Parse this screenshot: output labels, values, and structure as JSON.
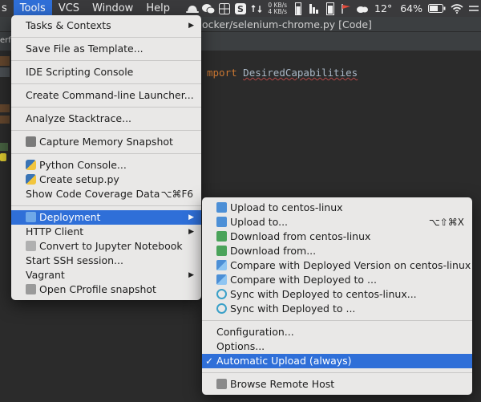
{
  "menubar": {
    "items": [
      "s",
      "Tools",
      "VCS",
      "Window",
      "Help"
    ],
    "net_up": "0 KB/s",
    "net_down": "4 KB/s",
    "temperature": "12°",
    "battery": "64%"
  },
  "ide": {
    "title": "ocker/selenium-chrome.py [Code]",
    "sub_fragment": "erf",
    "code_import_kw": "mport",
    "code_import_cls": "DesiredCapabilities"
  },
  "tools_menu": {
    "items": [
      {
        "label": "Tasks & Contexts"
      },
      {
        "label": "Save File as Template..."
      },
      {
        "label": "IDE Scripting Console"
      },
      {
        "label": "Create Command-line Launcher..."
      },
      {
        "label": "Analyze Stacktrace..."
      },
      {
        "label": "Capture Memory Snapshot"
      },
      {
        "label": "Python Console..."
      },
      {
        "label": "Create setup.py"
      },
      {
        "label": "Show Code Coverage Data",
        "shortcut": "⌥⌘F6"
      },
      {
        "label": "Deployment"
      },
      {
        "label": "HTTP Client"
      },
      {
        "label": "Convert to Jupyter Notebook"
      },
      {
        "label": "Start SSH session..."
      },
      {
        "label": "Vagrant"
      },
      {
        "label": "Open CProfile snapshot"
      }
    ]
  },
  "deploy_menu": {
    "items": [
      {
        "label": "Upload to centos-linux"
      },
      {
        "label": "Upload to...",
        "shortcut": "⌥⇧⌘X"
      },
      {
        "label": "Download from centos-linux"
      },
      {
        "label": "Download from..."
      },
      {
        "label": "Compare with Deployed Version on centos-linux"
      },
      {
        "label": "Compare with Deployed to ..."
      },
      {
        "label": "Sync with Deployed to centos-linux..."
      },
      {
        "label": "Sync with Deployed to ..."
      },
      {
        "label": "Configuration..."
      },
      {
        "label": "Options..."
      },
      {
        "label": "Automatic Upload (always)",
        "checked": true
      },
      {
        "label": "Browse Remote Host"
      }
    ]
  },
  "colors": {
    "highlight": "#2f6fd8",
    "menu_bg": "#e9e8e7",
    "editor_bg": "#2b2b2b"
  }
}
